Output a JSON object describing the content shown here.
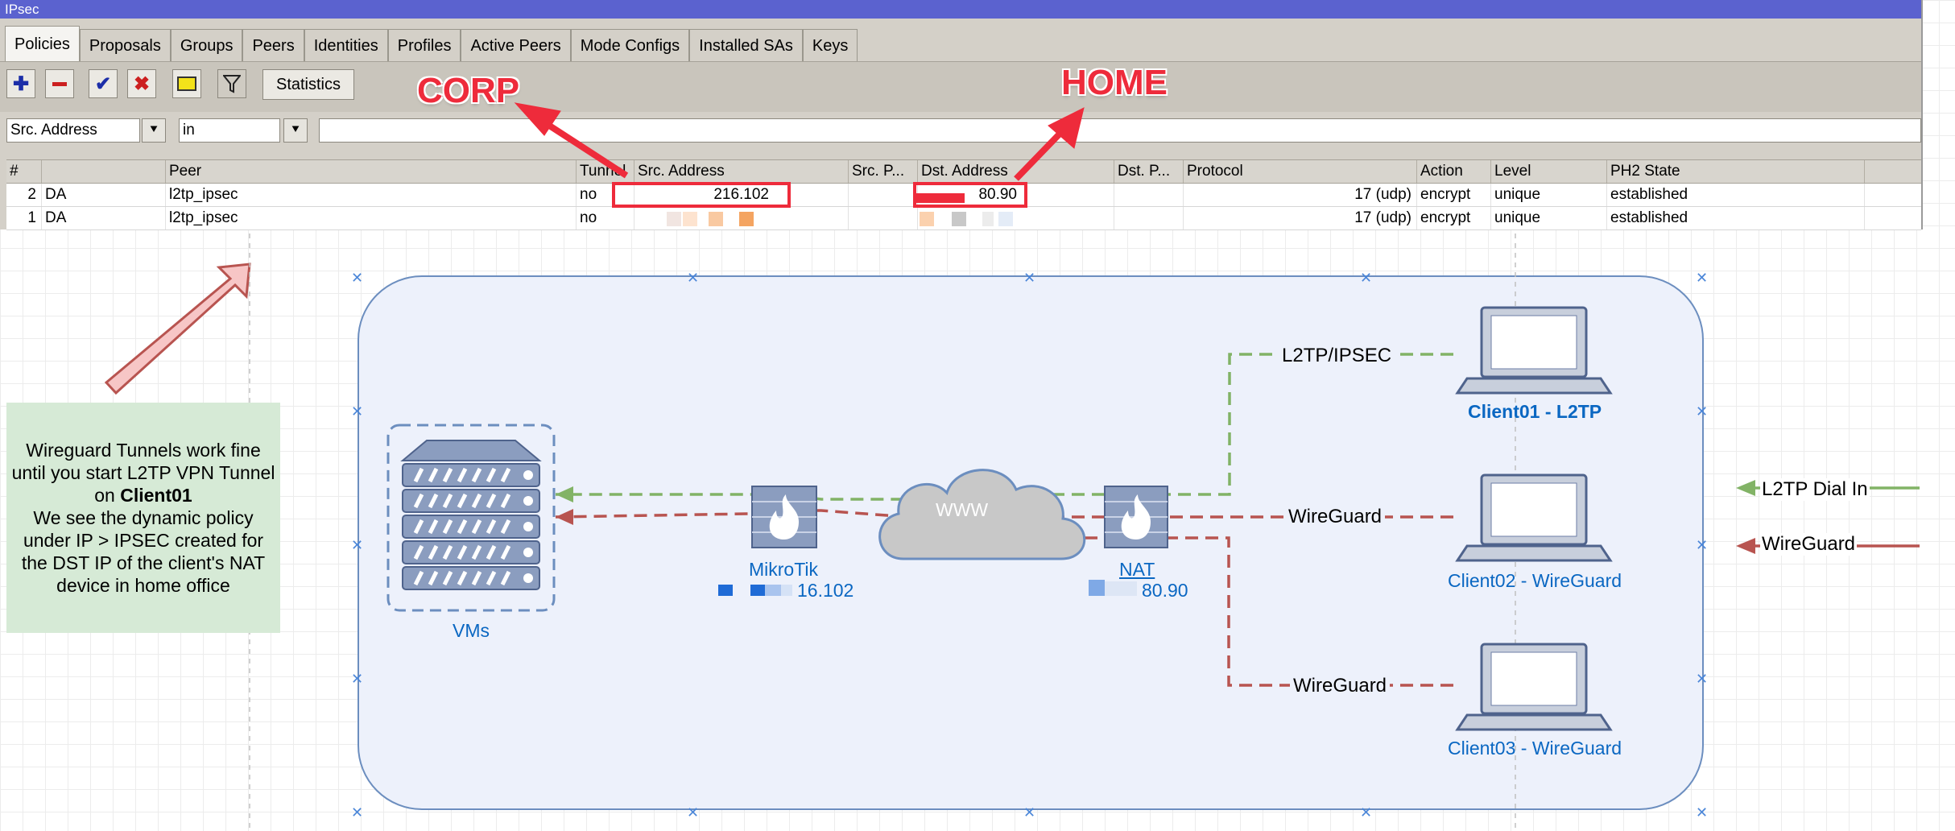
{
  "window": {
    "title": "IPsec"
  },
  "tabs": [
    "Policies",
    "Proposals",
    "Groups",
    "Peers",
    "Identities",
    "Profiles",
    "Active Peers",
    "Mode Configs",
    "Installed SAs",
    "Keys"
  ],
  "toolbar": {
    "statistics_label": "Statistics"
  },
  "filter": {
    "field": "Src. Address",
    "operator": "in",
    "value": ""
  },
  "table": {
    "columns": [
      "#",
      "",
      "Peer",
      "Tunnel",
      "Src. Address",
      "Src. P...",
      "Dst. Address",
      "Dst. P...",
      "Protocol",
      "Action",
      "Level",
      "PH2 State"
    ],
    "rows": [
      {
        "num": "2",
        "flags": "DA",
        "peer": "l2tp_ipsec",
        "tunnel": "no",
        "src": "216.102",
        "src_port": "",
        "dst": "80.90",
        "dst_port": "",
        "protocol": "17 (udp)",
        "action": "encrypt",
        "level": "unique",
        "state": "established"
      },
      {
        "num": "1",
        "flags": "DA",
        "peer": "l2tp_ipsec",
        "tunnel": "no",
        "src": "",
        "src_port": "",
        "dst": "",
        "dst_port": "",
        "protocol": "17 (udp)",
        "action": "encrypt",
        "level": "unique",
        "state": "established"
      }
    ]
  },
  "annotations": {
    "corp": "CORP",
    "home": "HOME"
  },
  "note": {
    "line1": "Wireguard Tunnels work fine until you start L2TP VPN Tunnel on ",
    "bold": "Client01",
    "line2": "We see the dynamic policy under IP > IPSEC created for the DST IP of the client's NAT device in home office"
  },
  "diagram": {
    "vms": "VMs",
    "mikrotik": "MikroTik",
    "mikrotik_ip": "16.102",
    "cloud": "WWW",
    "nat": "NAT",
    "nat_ip": "80.90",
    "client01": "Client01 - L2TP",
    "client02": "Client02 - WireGuard",
    "client03": "Client03 - WireGuard",
    "link1": "L2TP/IPSEC",
    "link2": "WireGuard",
    "link3": "WireGuard"
  },
  "legend": {
    "l2tp": "L2TP Dial In",
    "wireguard": "WireGuard"
  },
  "colors": {
    "title_bar": "#5b62cf",
    "annotation": "#ee2b3b",
    "l2tp_line": "#82b366",
    "wireguard_line": "#b85450",
    "panel_border": "#6c8ebf",
    "note_bg": "#d6ead6",
    "label_blue": "#0a67c2"
  }
}
